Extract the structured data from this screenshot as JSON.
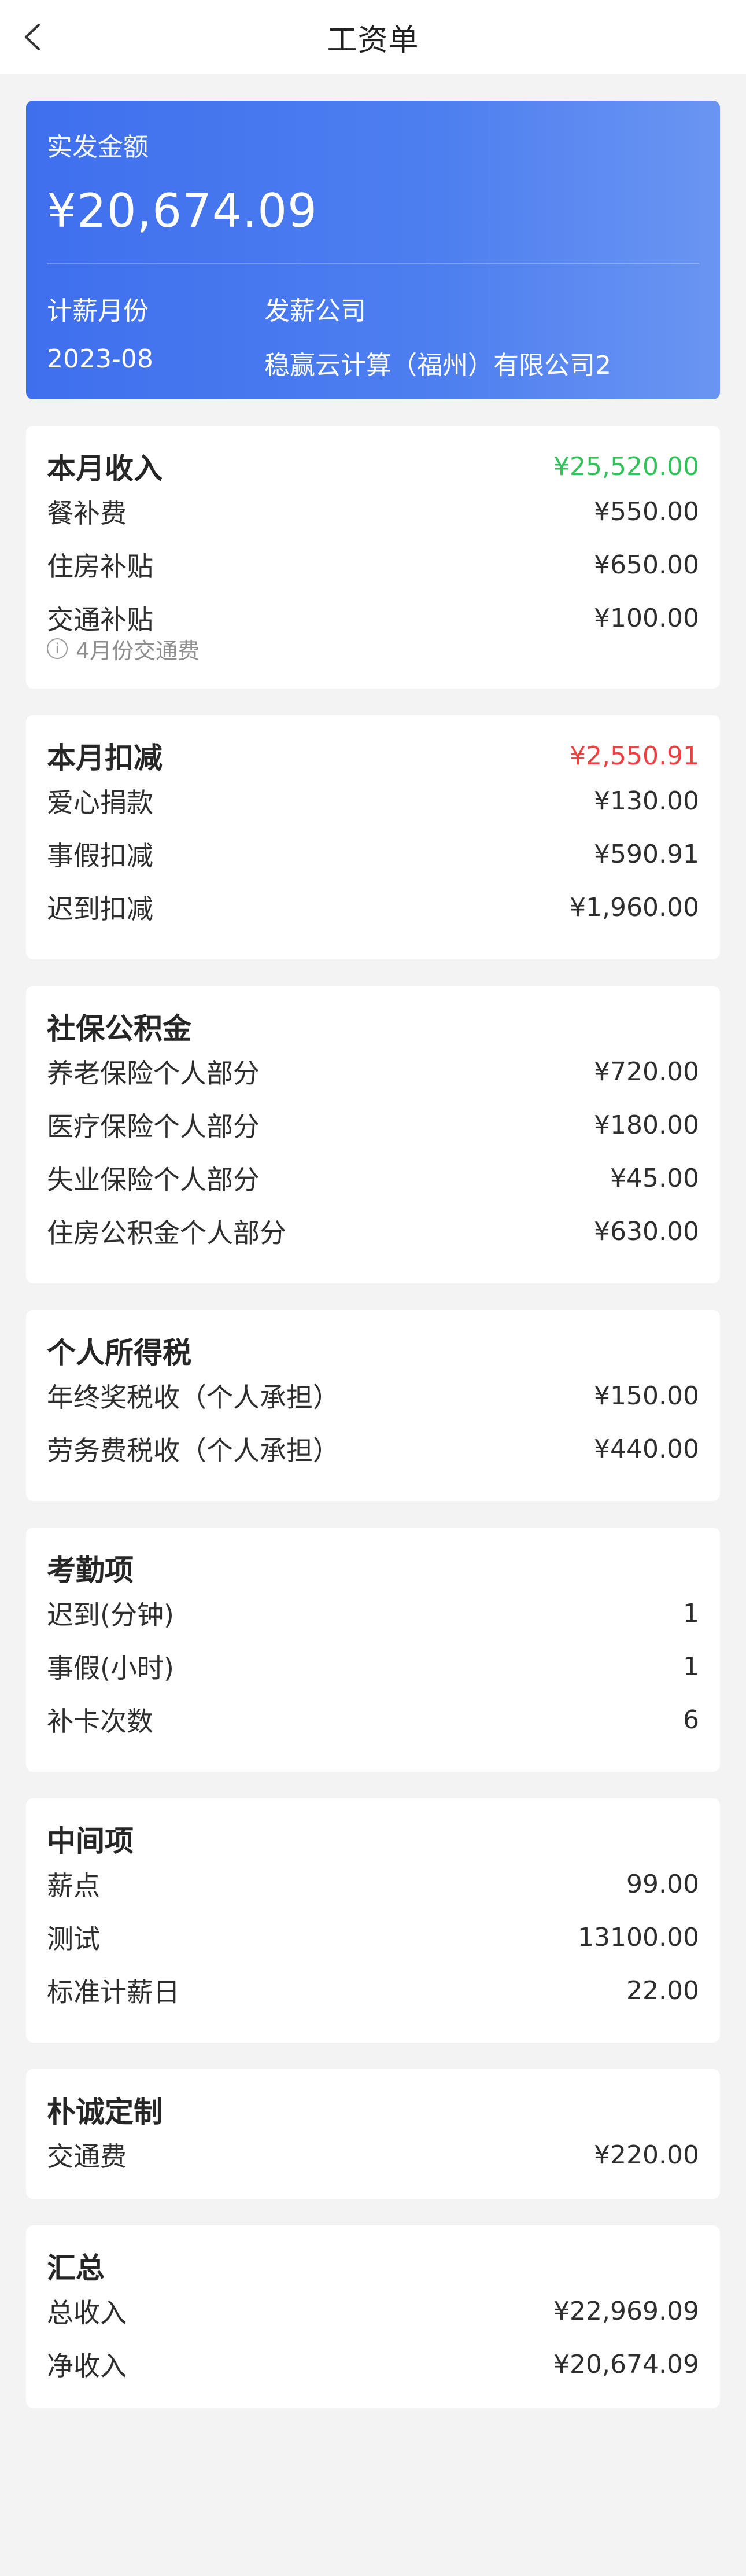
{
  "nav": {
    "title": "工资单",
    "back_icon": "chevron-left-icon"
  },
  "summary": {
    "label": "实发金额",
    "amount": "¥20,674.09",
    "month_label": "计薪月份",
    "month_value": "2023-08",
    "company_label": "发薪公司",
    "company_value": "稳赢云计算（福州）有限公司2",
    "gradient_colors": [
      "#3f6fed",
      "#6a95f2"
    ]
  },
  "colors": {
    "income_total": "#33c25a",
    "deduction_total": "#ee4040"
  },
  "sections": [
    {
      "title": "本月收入",
      "total": "¥25,520.00",
      "rows": [
        {
          "label": "餐补费",
          "value": "¥550.00"
        },
        {
          "label": "住房补贴",
          "value": "¥650.00"
        },
        {
          "label": "交通补贴",
          "value": "¥100.00",
          "note": "4月份交通费"
        }
      ]
    },
    {
      "title": "本月扣减",
      "total": "¥2,550.91",
      "rows": [
        {
          "label": "爱心捐款",
          "value": "¥130.00"
        },
        {
          "label": "事假扣减",
          "value": "¥590.91"
        },
        {
          "label": "迟到扣减",
          "value": "¥1,960.00"
        }
      ]
    },
    {
      "title": "社保公积金",
      "rows": [
        {
          "label": "养老保险个人部分",
          "value": "¥720.00"
        },
        {
          "label": "医疗保险个人部分",
          "value": "¥180.00"
        },
        {
          "label": "失业保险个人部分",
          "value": "¥45.00"
        },
        {
          "label": "住房公积金个人部分",
          "value": "¥630.00"
        }
      ]
    },
    {
      "title": "个人所得税",
      "rows": [
        {
          "label": "年终奖税收（个人承担）",
          "value": "¥150.00"
        },
        {
          "label": "劳务费税收（个人承担）",
          "value": "¥440.00"
        }
      ]
    },
    {
      "title": "考勤项",
      "rows": [
        {
          "label": "迟到(分钟)",
          "value": "1"
        },
        {
          "label": "事假(小时)",
          "value": "1"
        },
        {
          "label": "补卡次数",
          "value": "6"
        }
      ]
    },
    {
      "title": "中间项",
      "rows": [
        {
          "label": "薪点",
          "value": "99.00"
        },
        {
          "label": "测试",
          "value": "13100.00"
        },
        {
          "label": "标准计薪日",
          "value": "22.00"
        }
      ]
    },
    {
      "title": "朴诚定制",
      "rows": [
        {
          "label": "交通费",
          "value": "¥220.00"
        }
      ]
    },
    {
      "title": "汇总",
      "rows": [
        {
          "label": "总收入",
          "value": "¥22,969.09"
        },
        {
          "label": "净收入",
          "value": "¥20,674.09"
        }
      ]
    }
  ]
}
